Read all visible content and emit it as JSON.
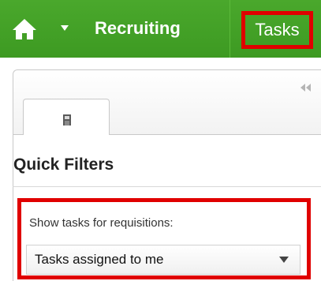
{
  "topbar": {
    "home_icon": "home-icon",
    "nav_item": "Recruiting",
    "tasks_item": "Tasks"
  },
  "panel": {
    "collapse_icon": "double-chevron-left-icon",
    "tab_icon": "user-icon",
    "title": "Quick Filters",
    "filter": {
      "label": "Show tasks for requisitions:",
      "selected_value": "Tasks assigned to me"
    }
  },
  "colors": {
    "topbar_green": "#3d9a22",
    "highlight_red": "#e00000"
  }
}
